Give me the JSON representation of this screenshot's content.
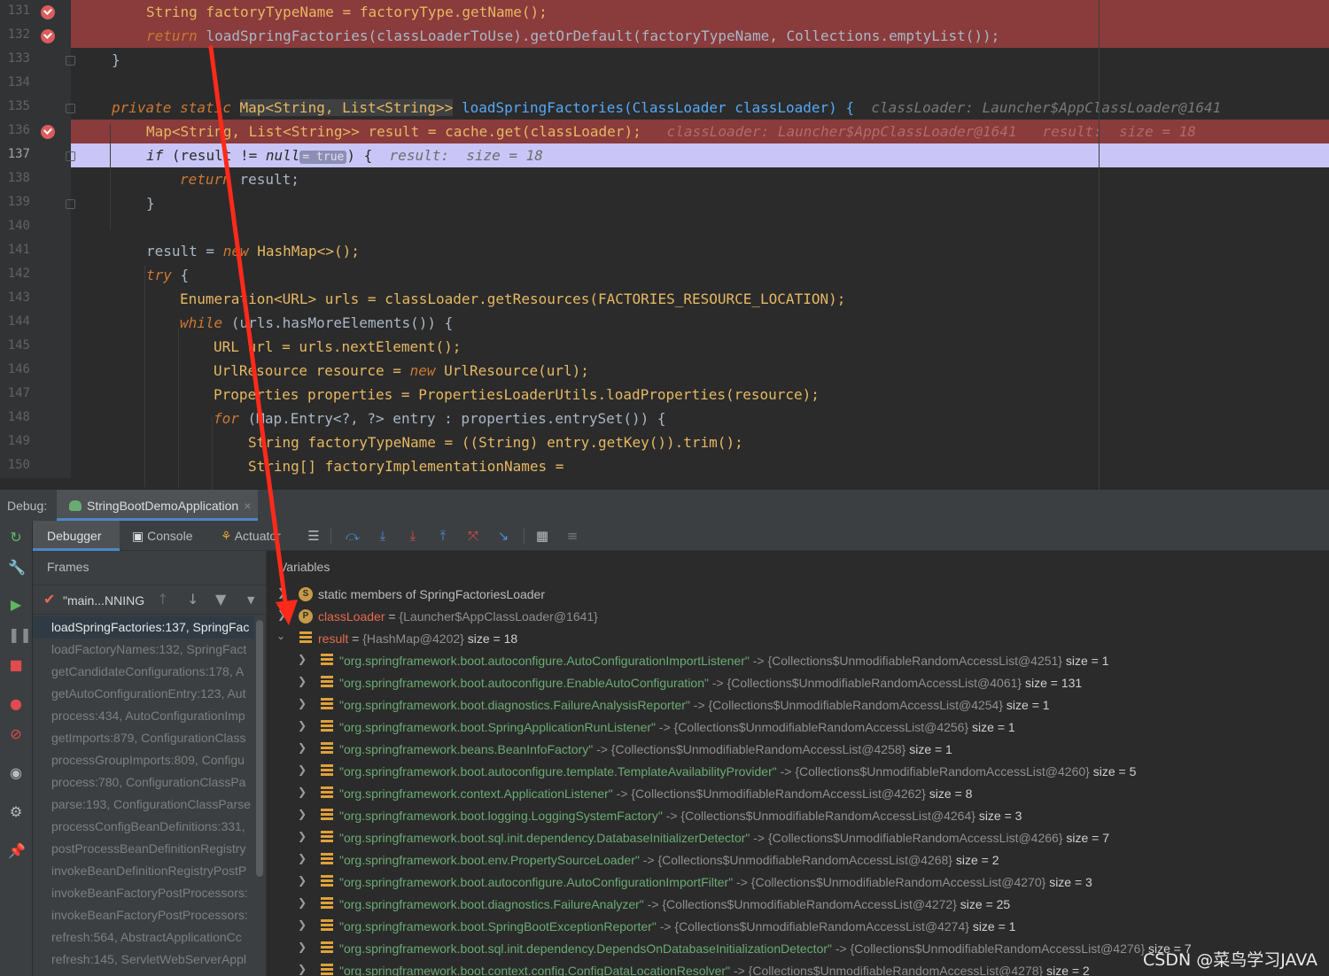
{
  "editor": {
    "lines": [
      {
        "num": "131",
        "bp": true
      },
      {
        "num": "132",
        "bp": true
      },
      {
        "num": "133"
      },
      {
        "num": "134"
      },
      {
        "num": "135"
      },
      {
        "num": "136",
        "bp": true
      },
      {
        "num": "137",
        "current": true
      },
      {
        "num": "138"
      },
      {
        "num": "139"
      },
      {
        "num": "140"
      },
      {
        "num": "141"
      },
      {
        "num": "142"
      },
      {
        "num": "143"
      },
      {
        "num": "144"
      },
      {
        "num": "145"
      },
      {
        "num": "146"
      },
      {
        "num": "147"
      },
      {
        "num": "148"
      },
      {
        "num": "149"
      },
      {
        "num": "150"
      }
    ],
    "code": {
      "l131": "String factoryTypeName = factoryType.getName();",
      "l132_kw": "return",
      "l132_rest": "loadSpringFactories(classLoaderToUse).getOrDefault(factoryTypeName, Collections.emptyList());",
      "l133": "}",
      "l135_kw": "private static",
      "l135_type": "Map<String, List<String>>",
      "l135_rest": "loadSpringFactories(ClassLoader classLoader) {",
      "l135_hint": "classLoader: Launcher$AppClassLoader@1641",
      "l136": "Map<String, List<String>> result = cache.get(classLoader);",
      "l136_hint1": "classLoader: Launcher$AppClassLoader@1641",
      "l136_hint2": "result:  size = 18",
      "l137_kw": "if",
      "l137_a": "(result != ",
      "l137_null": "null",
      "l137_inline": "= true",
      "l137_b": ") {",
      "l137_hint": "result:  size = 18",
      "l138_kw": "return",
      "l138_rest": "result;",
      "l139": "}",
      "l141_a": "result = ",
      "l141_kw": "new",
      "l141_b": "HashMap<>();",
      "l142_kw": "try",
      "l142_b": "{",
      "l143": "Enumeration<URL> urls = classLoader.getResources(FACTORIES_RESOURCE_LOCATION);",
      "l144_kw": "while",
      "l144_b": "(urls.hasMoreElements()) {",
      "l145": "URL url = urls.nextElement();",
      "l146_a": "UrlResource resource = ",
      "l146_kw": "new",
      "l146_b": "UrlResource(url);",
      "l147": "Properties properties = PropertiesLoaderUtils.loadProperties(resource);",
      "l148_kw": "for",
      "l148_b": "(Map.Entry<?, ?> entry : properties.entrySet()) {",
      "l149": "String factoryTypeName = ((String) entry.getKey()).trim();",
      "l150": "String[] factoryImplementationNames ="
    }
  },
  "debug": {
    "label": "Debug:",
    "session_tab": "StringBootDemoApplication",
    "tabs": {
      "debugger": "Debugger",
      "console": "Console",
      "actuator": "Actuator"
    },
    "frames_title": "Frames",
    "thread": "\"main...NNING",
    "frames": [
      "loadSpringFactories:137, SpringFac",
      "loadFactoryNames:132, SpringFact",
      "getCandidateConfigurations:178, A",
      "getAutoConfigurationEntry:123, Aut",
      "process:434, AutoConfigurationImp",
      "getImports:879, ConfigurationClass",
      "processGroupImports:809, Configu",
      "process:780, ConfigurationClassPa",
      "parse:193, ConfigurationClassParse",
      "processConfigBeanDefinitions:331,",
      "postProcessBeanDefinitionRegistry",
      "invokeBeanDefinitionRegistryPostP",
      "invokeBeanFactoryPostProcessors:",
      "invokeBeanFactoryPostProcessors:",
      "refresh:564, AbstractApplicationCc",
      "refresh:145, ServletWebServerAppl"
    ],
    "variables_title": "Variables",
    "static_members": "static members of SpringFactoriesLoader",
    "classloader_name": "classLoader",
    "classloader_value": "{Launcher$AppClassLoader@1641}",
    "result_name": "result",
    "result_value": "{HashMap@4202}",
    "result_size": "size = 18",
    "entries": [
      {
        "key": "\"org.springframework.boot.autoconfigure.AutoConfigurationImportListener\"",
        "val": "-> {Collections$UnmodifiableRandomAccessList@4251}",
        "size": "size = 1"
      },
      {
        "key": "\"org.springframework.boot.autoconfigure.EnableAutoConfiguration\"",
        "val": "-> {Collections$UnmodifiableRandomAccessList@4061}",
        "size": "size = 131"
      },
      {
        "key": "\"org.springframework.boot.diagnostics.FailureAnalysisReporter\"",
        "val": "-> {Collections$UnmodifiableRandomAccessList@4254}",
        "size": "size = 1"
      },
      {
        "key": "\"org.springframework.boot.SpringApplicationRunListener\"",
        "val": "-> {Collections$UnmodifiableRandomAccessList@4256}",
        "size": "size = 1"
      },
      {
        "key": "\"org.springframework.beans.BeanInfoFactory\"",
        "val": "-> {Collections$UnmodifiableRandomAccessList@4258}",
        "size": "size = 1"
      },
      {
        "key": "\"org.springframework.boot.autoconfigure.template.TemplateAvailabilityProvider\"",
        "val": "-> {Collections$UnmodifiableRandomAccessList@4260}",
        "size": "size = 5"
      },
      {
        "key": "\"org.springframework.context.ApplicationListener\"",
        "val": "-> {Collections$UnmodifiableRandomAccessList@4262}",
        "size": "size = 8"
      },
      {
        "key": "\"org.springframework.boot.logging.LoggingSystemFactory\"",
        "val": "-> {Collections$UnmodifiableRandomAccessList@4264}",
        "size": "size = 3"
      },
      {
        "key": "\"org.springframework.boot.sql.init.dependency.DatabaseInitializerDetector\"",
        "val": "-> {Collections$UnmodifiableRandomAccessList@4266}",
        "size": "size = 7"
      },
      {
        "key": "\"org.springframework.boot.env.PropertySourceLoader\"",
        "val": "-> {Collections$UnmodifiableRandomAccessList@4268}",
        "size": "size = 2"
      },
      {
        "key": "\"org.springframework.boot.autoconfigure.AutoConfigurationImportFilter\"",
        "val": "-> {Collections$UnmodifiableRandomAccessList@4270}",
        "size": "size = 3"
      },
      {
        "key": "\"org.springframework.boot.diagnostics.FailureAnalyzer\"",
        "val": "-> {Collections$UnmodifiableRandomAccessList@4272}",
        "size": "size = 25"
      },
      {
        "key": "\"org.springframework.boot.SpringBootExceptionReporter\"",
        "val": "-> {Collections$UnmodifiableRandomAccessList@4274}",
        "size": "size = 1"
      },
      {
        "key": "\"org.springframework.boot.sql.init.dependency.DependsOnDatabaseInitializationDetector\"",
        "val": "-> {Collections$UnmodifiableRandomAccessList@4276}",
        "size": "size = 7"
      },
      {
        "key": "\"org.springframework.boot.context.config.ConfigDataLocationResolver\"",
        "val": "-> {Collections$UnmodifiableRandomAccessList@4278}",
        "size": "size = 2"
      }
    ]
  },
  "watermark": "CSDN @菜鸟学习JAVA",
  "colors": {
    "breakpoint_line": "#8a3b3b",
    "current_line": "#c9c6f7",
    "keyword": "#cc7832",
    "method": "#56a8f5",
    "string": "#6aab73",
    "annotation_arrow": "#ff2a1a"
  }
}
